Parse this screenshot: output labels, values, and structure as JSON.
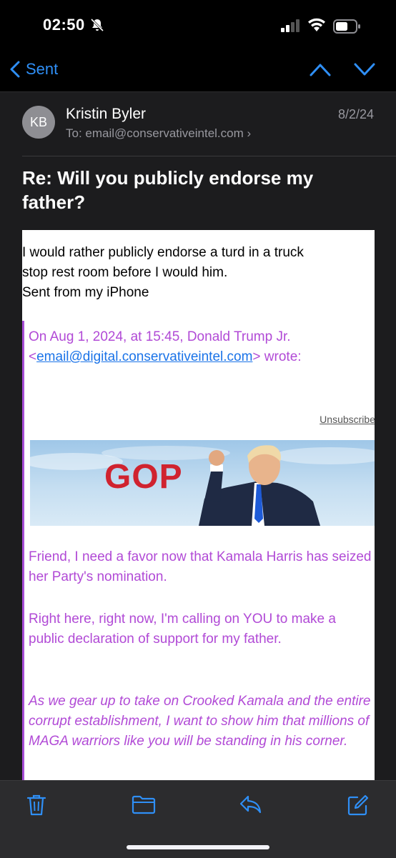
{
  "status_bar": {
    "time": "02:50"
  },
  "nav": {
    "back_label": "Sent"
  },
  "message": {
    "avatar_initials": "KB",
    "sender": "Kristin Byler",
    "to_label": "To:",
    "to_address": "email@conservativeintel.com",
    "date": "8/2/24",
    "subject": "Re: Will you publicly endorse my father?",
    "reply_lines": [
      "I would rather publicly endorse a turd in a truck",
      "stop rest room before I would him.",
      "Sent from my iPhone"
    ],
    "quote_header_line1": "On Aug 1, 2024, at 15:45, Donald Trump Jr.",
    "quote_header_lt": "<",
    "quote_email": "email@digital.conservativeintel.com",
    "quote_header_tail": "> wrote:",
    "unsubscribe": "Unsubscribe",
    "banner_text": "GOP",
    "paragraph1": "Friend, I need a favor now that Kamala Harris has seized her Party's nomination.",
    "paragraph2": "Right here, right now, I'm calling on YOU to make a public declaration of support for my father.",
    "paragraph3": "As we gear up to take on Crooked Kamala and the entire corrupt establishment, I want to show him that millions of MAGA warriors like you will be standing in his corner."
  },
  "colors": {
    "accent": "#2f8ff6",
    "quote_purple": "#b14ad6",
    "link_blue": "#1a73e8",
    "gop_red": "#d0232f"
  },
  "toolbar_icons": [
    "trash-icon",
    "folder-icon",
    "reply-icon",
    "compose-icon"
  ]
}
